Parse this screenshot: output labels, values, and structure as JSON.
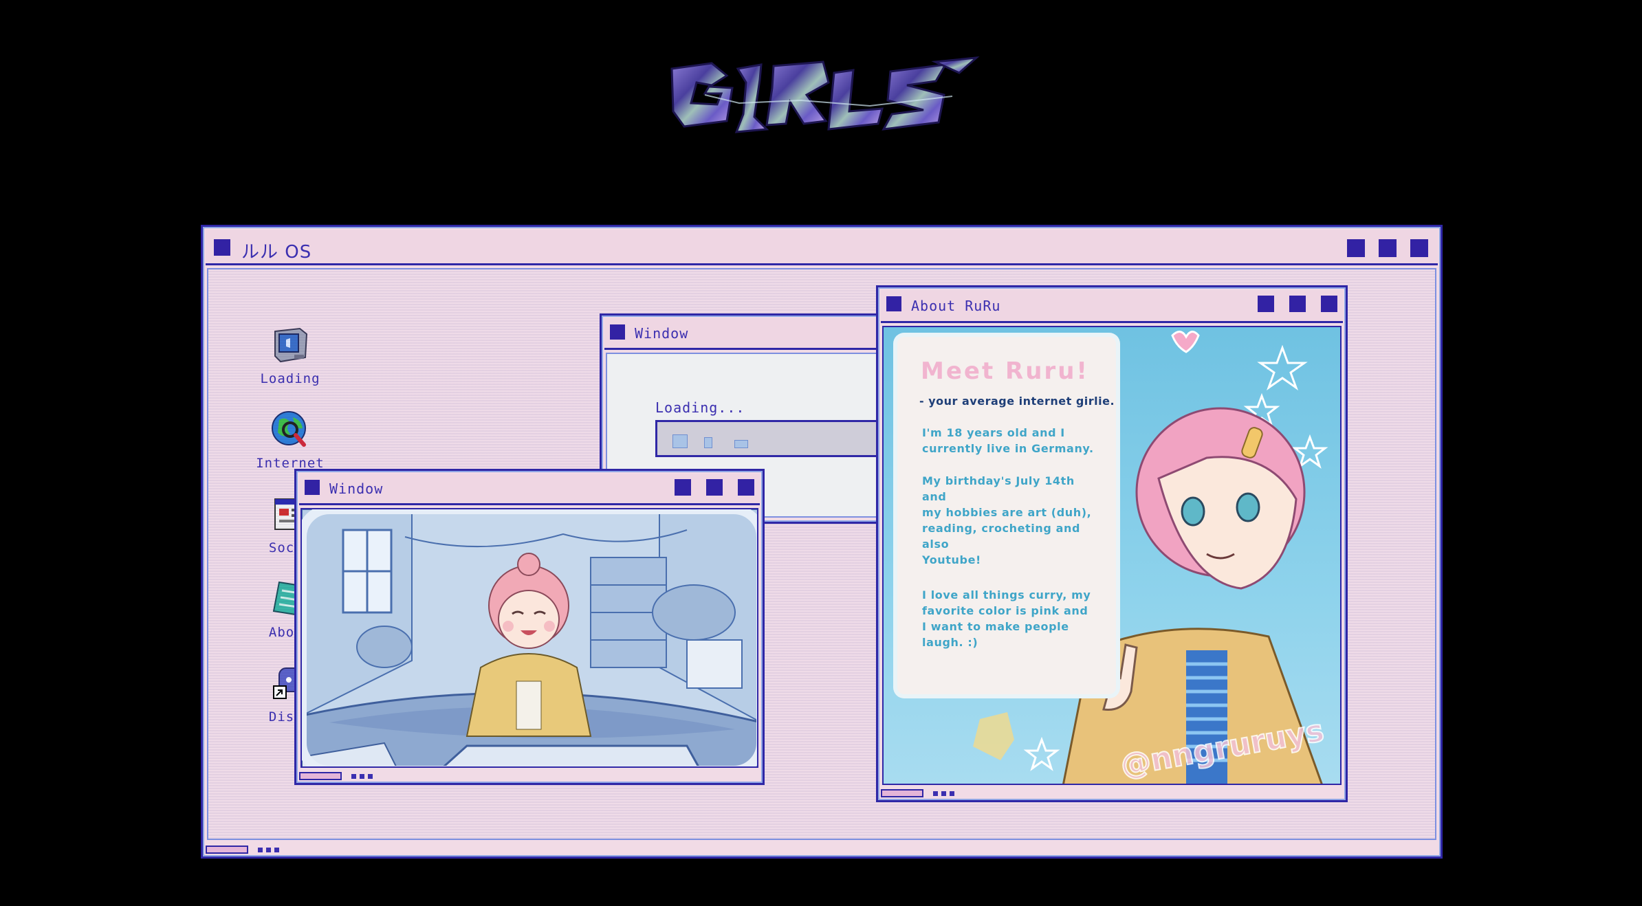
{
  "logo": {
    "text": "GIRLS"
  },
  "os_window": {
    "title": "ルル OS",
    "buttons": [
      "minimize",
      "maximize",
      "close"
    ]
  },
  "desktop": {
    "icons": [
      {
        "label": "Loading",
        "icon": "monitor-icon"
      },
      {
        "label": "Internet",
        "icon": "globe-icon"
      },
      {
        "label": "Socia",
        "icon": "social-window-icon"
      },
      {
        "label": "About",
        "icon": "notebook-icon"
      },
      {
        "label": "Disco",
        "icon": "discord-shortcut-icon"
      }
    ]
  },
  "loading_window": {
    "title": "Window",
    "loading_text": "Loading...",
    "progress": 0.2
  },
  "room_window": {
    "title": "Window",
    "image": "illustration of a girl with pink hair sitting in a cozy room"
  },
  "about_window": {
    "title": "About RuRu",
    "heading": "Meet Ruru!",
    "tagline": "- your average internet girlie.",
    "paragraphs": [
      "I'm 18 years old and I\ncurrently live in Germany.",
      "My birthday's July 14th\nand\nmy hobbies are art (duh),\nreading, crocheting and\nalso\nYoutube!",
      "I love all things curry, my\nfavorite color is pink and\nI want to make people\nlaugh. :)"
    ],
    "watermark": "@nngruruys"
  },
  "colors": {
    "background": "#000000",
    "window_border": "#2f27a6",
    "window_fill": "#efdbe8",
    "accent": "#3222a4",
    "text": "#3b2fb0",
    "pink": "#f1b4cf",
    "sky": "#6fc2e2"
  }
}
